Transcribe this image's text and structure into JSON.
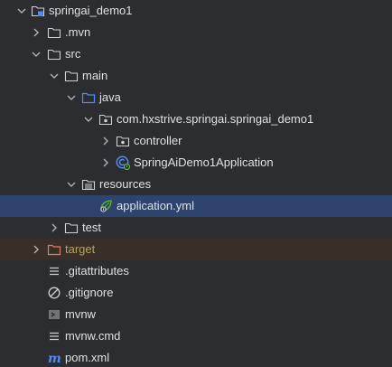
{
  "tree": {
    "root": {
      "label": "springai_demo1",
      "icon": "module-folder-icon",
      "expanded": true
    },
    "mvn": {
      "label": ".mvn",
      "icon": "folder-icon",
      "expanded": false
    },
    "src": {
      "label": "src",
      "icon": "folder-icon",
      "expanded": true
    },
    "main": {
      "label": "main",
      "icon": "folder-icon",
      "expanded": true
    },
    "java": {
      "label": "java",
      "icon": "source-root-folder-icon",
      "expanded": true
    },
    "package": {
      "label": "com.hxstrive.springai.springai_demo1",
      "icon": "package-icon",
      "expanded": true
    },
    "controller": {
      "label": "controller",
      "icon": "package-icon",
      "expanded": false
    },
    "app_class": {
      "label": "SpringAiDemo1Application",
      "icon": "spring-boot-class-icon",
      "expanded": false
    },
    "resources": {
      "label": "resources",
      "icon": "resources-folder-icon",
      "expanded": true
    },
    "application_yml": {
      "label": "application.yml",
      "icon": "spring-leaf-config-icon",
      "selected": true
    },
    "test": {
      "label": "test",
      "icon": "folder-icon",
      "expanded": false
    },
    "target": {
      "label": "target",
      "icon": "excluded-folder-icon",
      "expanded": false,
      "color": "#b3a35b"
    },
    "gitattributes": {
      "label": ".gitattributes",
      "icon": "text-lines-icon"
    },
    "gitignore": {
      "label": ".gitignore",
      "icon": "ignore-icon"
    },
    "mvnw": {
      "label": "mvnw",
      "icon": "shell-script-icon"
    },
    "mvnw_cmd": {
      "label": "mvnw.cmd",
      "icon": "text-lines-icon"
    },
    "pom": {
      "label": "pom.xml",
      "icon": "maven-icon"
    }
  },
  "colors": {
    "background": "#2b2d30",
    "selected_row": "#2e436e",
    "excluded_row": "#3a2f27",
    "text": "#dfe1e5",
    "excluded_text": "#b3a35b",
    "source_root_blue": "#548af7",
    "spring_green": "#5fb832"
  }
}
